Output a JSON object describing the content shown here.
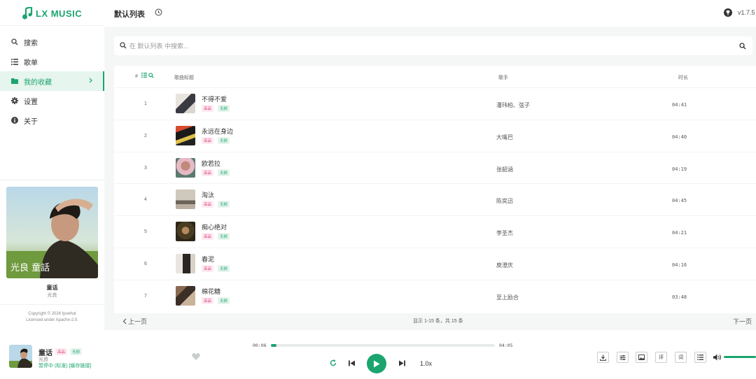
{
  "app": {
    "logo_text": "LX MUSIC",
    "version": "v1.7.5"
  },
  "colors": {
    "accent": "#1aa56e",
    "tag_quality": "#e0407b",
    "tag_source": "#1aa56e",
    "panel_bg": "#f5f7f6"
  },
  "sidebar": {
    "items": [
      {
        "label": "搜索",
        "icon": "search-icon"
      },
      {
        "label": "歌单",
        "icon": "list-icon"
      },
      {
        "label": "我的收藏",
        "icon": "folder-icon",
        "active": true
      },
      {
        "label": "设置",
        "icon": "gear-icon"
      },
      {
        "label": "关于",
        "icon": "info-icon"
      }
    ],
    "now_playing": {
      "title": "童话",
      "artist": "光良",
      "cover_text": "光良 童話"
    },
    "copyright": [
      "Copyright © 2026 lyswhut",
      "Licensed under Apache-2.0."
    ]
  },
  "header": {
    "title": "默认列表"
  },
  "search": {
    "placeholder": "在 默认列表 中搜索..."
  },
  "table": {
    "columns": {
      "num": "#",
      "title": "歌曲标题",
      "artist": "歌手",
      "duration": "时长"
    },
    "rows": [
      {
        "num": "1",
        "title": "不得不爱",
        "tag_quality": "高品",
        "tag_source": "无损",
        "artist": "潘玮柏、弦子",
        "duration": "04:41"
      },
      {
        "num": "2",
        "title": "永远在身边",
        "tag_quality": "高品",
        "tag_source": "无损",
        "artist": "大嘴巴",
        "duration": "04:40"
      },
      {
        "num": "3",
        "title": "欧若拉",
        "tag_quality": "高品",
        "tag_source": "无损",
        "artist": "张韶涵",
        "duration": "04:19"
      },
      {
        "num": "4",
        "title": "淘汰",
        "tag_quality": "高品",
        "tag_source": "无损",
        "artist": "陈奕迅",
        "duration": "04:45"
      },
      {
        "num": "5",
        "title": "痴心绝对",
        "tag_quality": "高品",
        "tag_source": "无损",
        "artist": "李圣杰",
        "duration": "04:21"
      },
      {
        "num": "6",
        "title": "春泥",
        "tag_quality": "高品",
        "tag_source": "无损",
        "artist": "庾澄庆",
        "duration": "04:16"
      },
      {
        "num": "7",
        "title": "棉花糖",
        "tag_quality": "高品",
        "tag_source": "无损",
        "artist": "至上励合",
        "duration": "03:48"
      }
    ]
  },
  "pager": {
    "prev": "上一页",
    "info": "显示 1-15 条，共 15 条",
    "next": "下一页"
  },
  "player": {
    "title": "童话",
    "tag_quality": "高品",
    "tag_source": "无损",
    "artist": "光良",
    "status": "暂停中 (标准) [缓存链接]",
    "current_time": "00:06",
    "total_time": "04:05",
    "progress": 0.025,
    "speed": "1.0x",
    "volume": 1.0,
    "tools": [
      "download-icon",
      "equalizer-icon",
      "image-icon",
      "评",
      "词",
      "list-icon"
    ]
  }
}
